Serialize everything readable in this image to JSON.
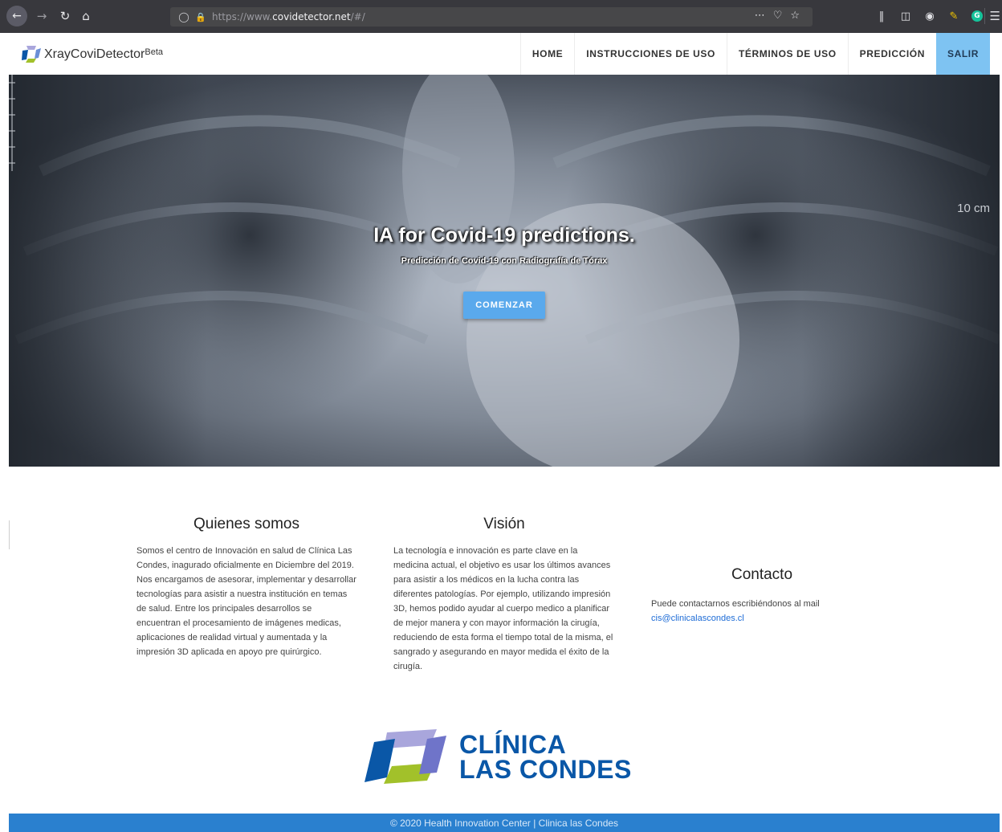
{
  "browser": {
    "url_prefix": "https://www.",
    "url_host": "covidetector.net",
    "url_suffix": "/#/",
    "icons": [
      "back-arrow-icon",
      "forward-arrow-icon",
      "reload-icon",
      "home-icon",
      "shield-icon",
      "lock-icon",
      "more-icon",
      "pocket-icon",
      "star-icon",
      "library-icon",
      "sidebar-icon",
      "account-icon",
      "pencil-extension-icon",
      "grammarly-icon",
      "menu-icon"
    ]
  },
  "navbar": {
    "brand": "XrayCoviDetector",
    "brand_sup": "Beta",
    "links": [
      "HOME",
      "INSTRUCCIONES DE USO",
      "TÉRMINOS DE USO",
      "PREDICCIÓN",
      "SALIR"
    ]
  },
  "hero": {
    "title": "IA for Covid-19 predictions.",
    "subtitle": "Predicción de Covid-19 con Radiografía de Tórax",
    "button": "COMENZAR",
    "ruler_label": "10 cm"
  },
  "sections": {
    "about": {
      "title": "Quienes somos",
      "body": "Somos el centro de Innovación en salud de Clínica Las Condes, inagurado oficialmente en Diciembre del 2019. Nos encargamos de asesorar, implementar y desarrollar tecnologías para asistir a nuestra institución en temas de salud. Entre los principales desarrollos se encuentran el procesamiento de imágenes medicas, aplicaciones de realidad virtual y aumentada y la impresión 3D aplicada en apoyo pre quirúrgico."
    },
    "vision": {
      "title": "Visión",
      "body": "La tecnología e innovación es parte clave en la medicina actual, el objetivo es usar los últimos avances para asistir a los médicos en la lucha contra las diferentes patologías. Por ejemplo, utilizando impresión 3D, hemos podido ayudar al cuerpo medico a planificar de mejor manera y con mayor información la cirugía, reduciendo de esta forma el tiempo total de la misma, el sangrado y asegurando en mayor medida el éxito de la cirugía."
    },
    "contact": {
      "title": "Contacto",
      "body": "Puede contactarnos escribiéndonos al mail",
      "email": "cis@clinicalascondes.cl"
    }
  },
  "logo": {
    "line1": "CLÍNICA",
    "line2": "LAS CONDES"
  },
  "footer": {
    "text": "© 2020 Health Innovation Center | Clinica las Condes"
  },
  "colors": {
    "accent": "#5aa9ec",
    "salir_bg": "#7ec3f2",
    "footer_bg": "#2a80cf",
    "logo_blue": "#0a57a7",
    "logo_lavender": "#a9a6dc",
    "logo_green": "#a2c12a"
  }
}
